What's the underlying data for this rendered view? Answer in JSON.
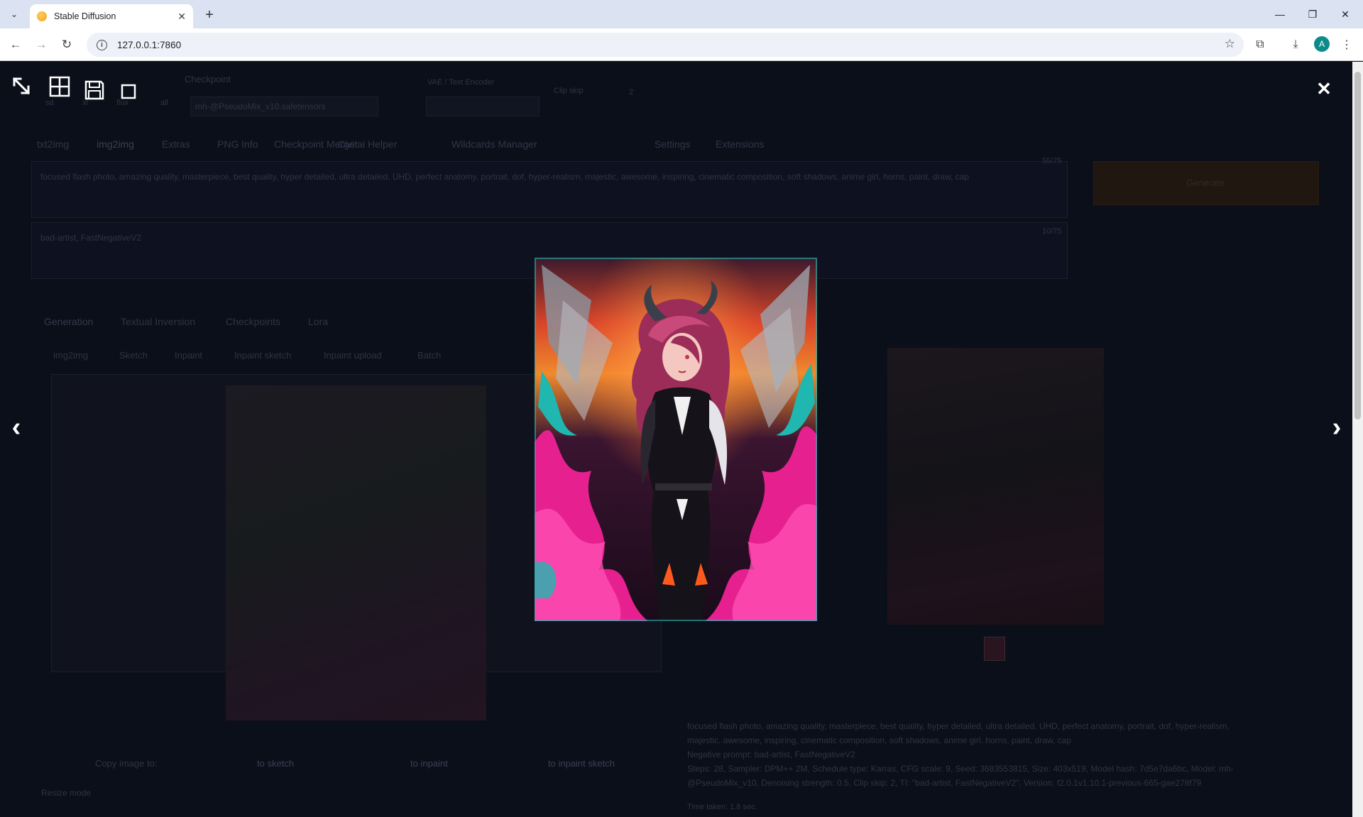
{
  "browser": {
    "tab_title": "Stable Diffusion",
    "url": "127.0.0.1:7860",
    "profile_initial": "A"
  },
  "webui": {
    "checkpoint_label": "Checkpoint",
    "vae_label": "VAE / Text Encoder",
    "clip_label": "Clip skip",
    "clip_value": "2",
    "model_type_options": [
      "sd",
      "xl",
      "flux",
      "all"
    ],
    "checkpoint_value": "mh-@PseudoMix_v10.safetensors",
    "main_tabs": [
      "txt2img",
      "img2img",
      "Extras",
      "PNG Info",
      "Checkpoint Merger",
      "Civitai Helper",
      "Wildcards Manager",
      "Settings",
      "Extensions"
    ],
    "prompt_text": "focused flash photo, amazing quality, masterpiece, best quality, hyper detailed, ultra detailed, UHD, perfect anatomy, portrait, dof, hyper-realism, majestic, awesome, inspiring, cinematic composition, soft shadows, anime girl, horns, paint, draw, cap",
    "prompt_counter": "55/75",
    "negative_prompt_text": "bad-artist, FastNegativeV2",
    "negative_counter": "10/75",
    "generate_label": "Generate",
    "section_tabs": [
      "Generation",
      "Textual Inversion",
      "Checkpoints",
      "Lora"
    ],
    "img2img_subtabs": [
      "img2img",
      "Sketch",
      "Inpaint",
      "Inpaint sketch",
      "Inpaint upload",
      "Batch"
    ],
    "copy_buttons": [
      "Copy image to:",
      "to sketch",
      "to inpaint",
      "to inpaint sketch"
    ],
    "resize_mode_label": "Resize mode",
    "output_info": "focused flash photo, amazing quality, masterpiece, best quality, hyper detailed, ultra detailed, UHD, perfect anatomy, portrait, dof, hyper-realism, majestic, awesome, inspiring, cinematic composition, soft shadows, anime girl, horns, paint, draw, cap",
    "output_negative": "Negative prompt: bad-artist, FastNegativeV2",
    "output_params": "Steps: 28, Sampler: DPM++ 2M, Schedule type: Karras, CFG scale: 9, Seed: 3683553815, Size: 403x519, Model hash: 7d5e7da6bc, Model: mh-@PseudoMix_v10, Denoising strength: 0.5, Clip skip: 2, TI: \"bad-artist, FastNegativeV2\", Version: f2.0.1v1.10.1-previous-665-gae278f79",
    "time_taken": "Time taken: 1.8 sec."
  },
  "lightbox": {
    "toolbar_icons": [
      "expand-icon",
      "tile-icon",
      "save-icon",
      "fullscreen-icon"
    ],
    "close_glyph": "✕",
    "prev_glyph": "‹",
    "next_glyph": "›"
  },
  "colors": {
    "overlay_bg": "#0b0f19",
    "accent_orange": "#f97316",
    "image_magenta": "#e6208f"
  }
}
